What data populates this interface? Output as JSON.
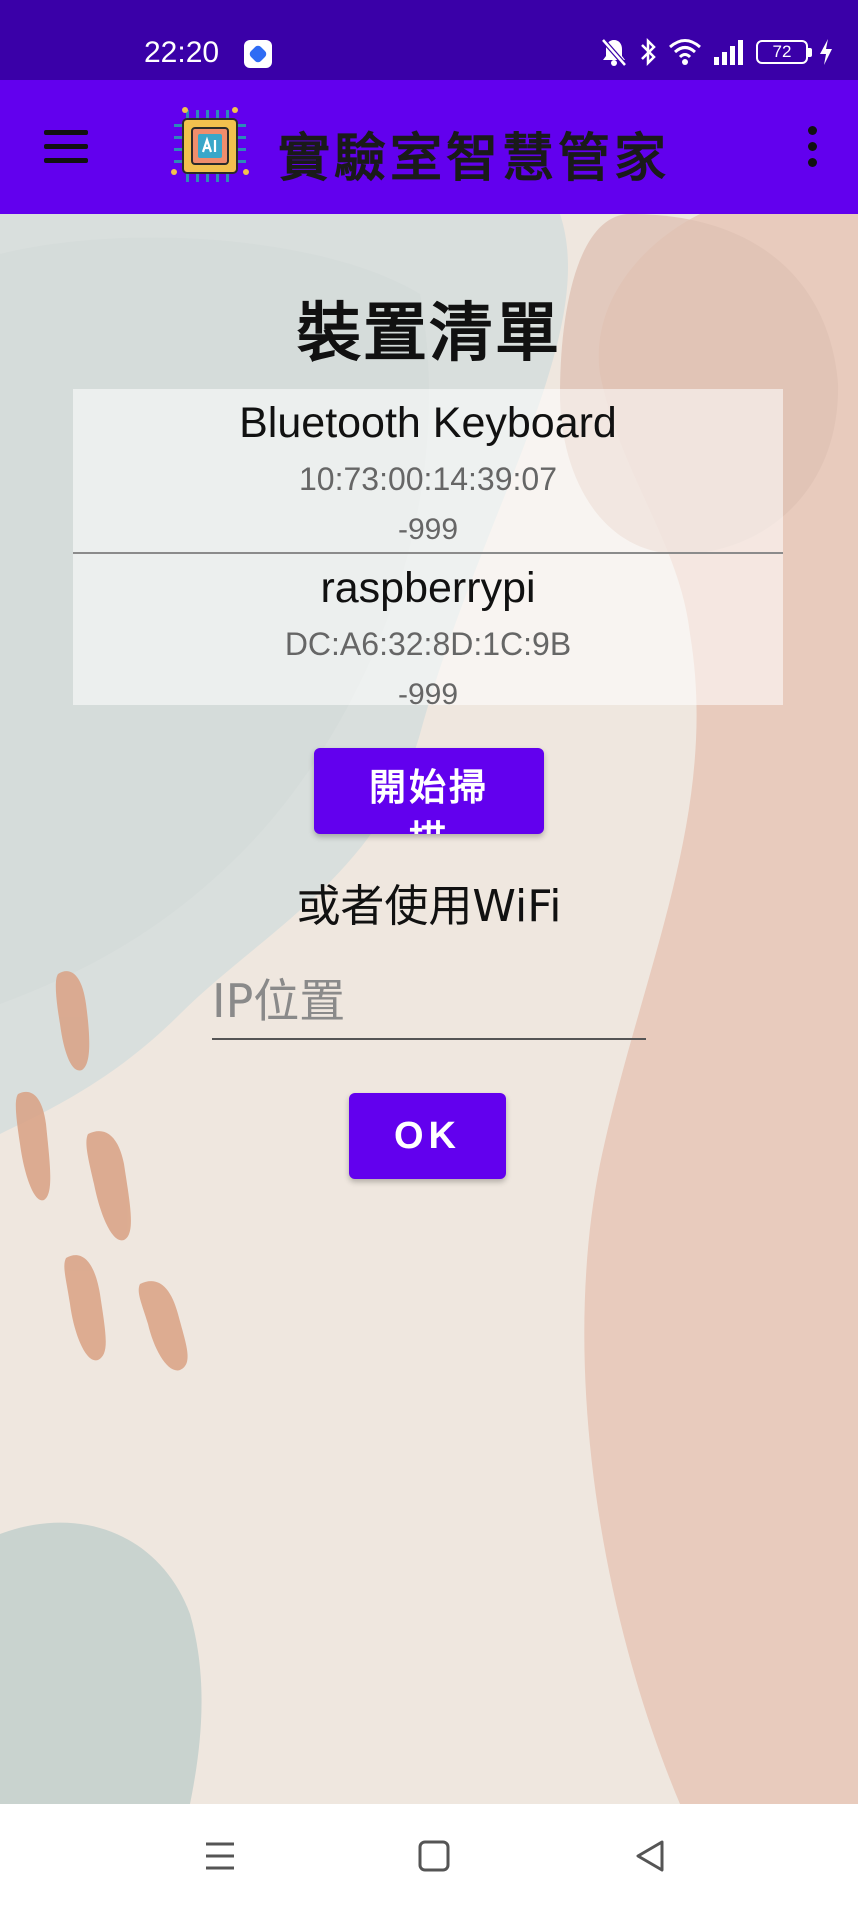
{
  "status_bar": {
    "time": "22:20",
    "battery_level": "72",
    "background_color": "#3a00a8"
  },
  "app_bar": {
    "title": "實驗室智慧管家",
    "background_color": "#6200ee",
    "menu_icon": "hamburger-menu-icon",
    "logo_icon": "ai-chip-icon",
    "overflow_icon": "more-vertical-icon"
  },
  "main": {
    "page_title": "裝置清單",
    "devices": [
      {
        "name": "Bluetooth Keyboard",
        "mac": "10:73:00:14:39:07",
        "rssi": "-999"
      },
      {
        "name": "raspberrypi",
        "mac": "DC:A6:32:8D:1C:9B",
        "rssi": "-999"
      }
    ],
    "scan_button_label": "開始掃描",
    "wifi_label": "或者使用WiFi",
    "ip_placeholder": "IP位置",
    "ok_button_label": "OK",
    "accent_color": "#6200ee"
  },
  "nav_bar": {
    "icons": [
      "recent-apps-icon",
      "home-icon",
      "back-icon"
    ]
  }
}
